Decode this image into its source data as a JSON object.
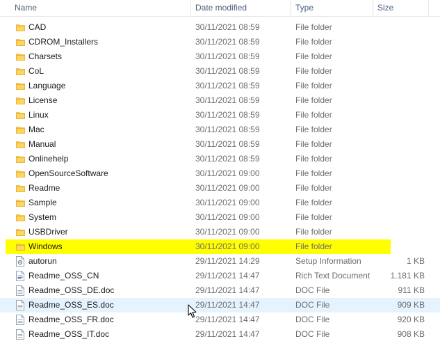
{
  "columns": {
    "name": "Name",
    "date": "Date modified",
    "type": "Type",
    "size": "Size",
    "sort_caret": "^"
  },
  "icons": {
    "folder": "folder-icon",
    "setup": "setup-info-icon",
    "rtf": "rich-text-icon",
    "doc": "doc-file-icon",
    "folder_color": "#f5c842",
    "highlight_color": "#ffff00",
    "hover_color": "#e5f3ff"
  },
  "rows": [
    {
      "name": "CAD",
      "date": "30/11/2021 08:59",
      "type": "File folder",
      "size": "",
      "icon": "folder"
    },
    {
      "name": "CDROM_Installers",
      "date": "30/11/2021 08:59",
      "type": "File folder",
      "size": "",
      "icon": "folder"
    },
    {
      "name": "Charsets",
      "date": "30/11/2021 08:59",
      "type": "File folder",
      "size": "",
      "icon": "folder"
    },
    {
      "name": "CoL",
      "date": "30/11/2021 08:59",
      "type": "File folder",
      "size": "",
      "icon": "folder"
    },
    {
      "name": "Language",
      "date": "30/11/2021 08:59",
      "type": "File folder",
      "size": "",
      "icon": "folder"
    },
    {
      "name": "License",
      "date": "30/11/2021 08:59",
      "type": "File folder",
      "size": "",
      "icon": "folder"
    },
    {
      "name": "Linux",
      "date": "30/11/2021 08:59",
      "type": "File folder",
      "size": "",
      "icon": "folder"
    },
    {
      "name": "Mac",
      "date": "30/11/2021 08:59",
      "type": "File folder",
      "size": "",
      "icon": "folder"
    },
    {
      "name": "Manual",
      "date": "30/11/2021 08:59",
      "type": "File folder",
      "size": "",
      "icon": "folder"
    },
    {
      "name": "Onlinehelp",
      "date": "30/11/2021 08:59",
      "type": "File folder",
      "size": "",
      "icon": "folder"
    },
    {
      "name": "OpenSourceSoftware",
      "date": "30/11/2021 09:00",
      "type": "File folder",
      "size": "",
      "icon": "folder"
    },
    {
      "name": "Readme",
      "date": "30/11/2021 09:00",
      "type": "File folder",
      "size": "",
      "icon": "folder"
    },
    {
      "name": "Sample",
      "date": "30/11/2021 09:00",
      "type": "File folder",
      "size": "",
      "icon": "folder"
    },
    {
      "name": "System",
      "date": "30/11/2021 09:00",
      "type": "File folder",
      "size": "",
      "icon": "folder"
    },
    {
      "name": "USBDriver",
      "date": "30/11/2021 09:00",
      "type": "File folder",
      "size": "",
      "icon": "folder"
    },
    {
      "name": "Windows",
      "date": "30/11/2021 09:00",
      "type": "File folder",
      "size": "",
      "icon": "folder",
      "highlighted": true
    },
    {
      "name": "autorun",
      "date": "29/11/2021 14:29",
      "type": "Setup Information",
      "size": "1 KB",
      "icon": "setup"
    },
    {
      "name": "Readme_OSS_CN",
      "date": "29/11/2021 14:47",
      "type": "Rich Text Document",
      "size": "1.181 KB",
      "icon": "rtf"
    },
    {
      "name": "Readme_OSS_DE.doc",
      "date": "29/11/2021 14:47",
      "type": "DOC File",
      "size": "911 KB",
      "icon": "doc"
    },
    {
      "name": "Readme_OSS_ES.doc",
      "date": "29/11/2021 14:47",
      "type": "DOC File",
      "size": "909 KB",
      "icon": "doc",
      "hover": true
    },
    {
      "name": "Readme_OSS_FR.doc",
      "date": "29/11/2021 14:47",
      "type": "DOC File",
      "size": "920 KB",
      "icon": "doc"
    },
    {
      "name": "Readme_OSS_IT.doc",
      "date": "29/11/2021 14:47",
      "type": "DOC File",
      "size": "908 KB",
      "icon": "doc"
    }
  ]
}
